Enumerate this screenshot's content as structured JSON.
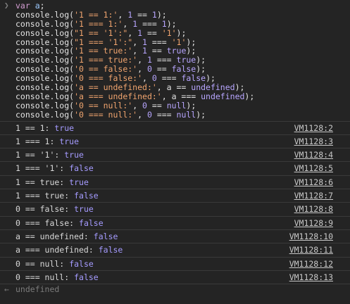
{
  "input_code": [
    [
      {
        "t": "var",
        "c": "kw"
      },
      {
        "t": " a",
        "c": "var"
      },
      {
        "t": ";",
        "c": "plain"
      }
    ],
    [
      {
        "t": "console.log(",
        "c": "plain"
      },
      {
        "t": "'1 == 1:'",
        "c": "str"
      },
      {
        "t": ", ",
        "c": "plain"
      },
      {
        "t": "1",
        "c": "num"
      },
      {
        "t": " == ",
        "c": "plain"
      },
      {
        "t": "1",
        "c": "num"
      },
      {
        "t": ");",
        "c": "plain"
      }
    ],
    [
      {
        "t": "console.log(",
        "c": "plain"
      },
      {
        "t": "'1 === 1:'",
        "c": "str"
      },
      {
        "t": ", ",
        "c": "plain"
      },
      {
        "t": "1",
        "c": "num"
      },
      {
        "t": " === ",
        "c": "plain"
      },
      {
        "t": "1",
        "c": "num"
      },
      {
        "t": ");",
        "c": "plain"
      }
    ],
    [
      {
        "t": "console.log(",
        "c": "plain"
      },
      {
        "t": "\"1 == '1':\"",
        "c": "str"
      },
      {
        "t": ", ",
        "c": "plain"
      },
      {
        "t": "1",
        "c": "num"
      },
      {
        "t": " == ",
        "c": "plain"
      },
      {
        "t": "'1'",
        "c": "str"
      },
      {
        "t": ");",
        "c": "plain"
      }
    ],
    [
      {
        "t": "console.log(",
        "c": "plain"
      },
      {
        "t": "\"1 === '1':\"",
        "c": "str"
      },
      {
        "t": ", ",
        "c": "plain"
      },
      {
        "t": "1",
        "c": "num"
      },
      {
        "t": " === ",
        "c": "plain"
      },
      {
        "t": "'1'",
        "c": "str"
      },
      {
        "t": ");",
        "c": "plain"
      }
    ],
    [
      {
        "t": "console.log(",
        "c": "plain"
      },
      {
        "t": "'1 == true:'",
        "c": "str"
      },
      {
        "t": ", ",
        "c": "plain"
      },
      {
        "t": "1",
        "c": "num"
      },
      {
        "t": " == ",
        "c": "plain"
      },
      {
        "t": "true",
        "c": "lit"
      },
      {
        "t": ");",
        "c": "plain"
      }
    ],
    [
      {
        "t": "console.log(",
        "c": "plain"
      },
      {
        "t": "'1 === true:'",
        "c": "str"
      },
      {
        "t": ", ",
        "c": "plain"
      },
      {
        "t": "1",
        "c": "num"
      },
      {
        "t": " === ",
        "c": "plain"
      },
      {
        "t": "true",
        "c": "lit"
      },
      {
        "t": ");",
        "c": "plain"
      }
    ],
    [
      {
        "t": "console.log(",
        "c": "plain"
      },
      {
        "t": "'0 == false:'",
        "c": "str"
      },
      {
        "t": ", ",
        "c": "plain"
      },
      {
        "t": "0",
        "c": "num"
      },
      {
        "t": " == ",
        "c": "plain"
      },
      {
        "t": "false",
        "c": "lit"
      },
      {
        "t": ");",
        "c": "plain"
      }
    ],
    [
      {
        "t": "console.log(",
        "c": "plain"
      },
      {
        "t": "'0 === false:'",
        "c": "str"
      },
      {
        "t": ", ",
        "c": "plain"
      },
      {
        "t": "0",
        "c": "num"
      },
      {
        "t": " === ",
        "c": "plain"
      },
      {
        "t": "false",
        "c": "lit"
      },
      {
        "t": ");",
        "c": "plain"
      }
    ],
    [
      {
        "t": "console.log(",
        "c": "plain"
      },
      {
        "t": "'a == undefined:'",
        "c": "str"
      },
      {
        "t": ", a == ",
        "c": "plain"
      },
      {
        "t": "undefined",
        "c": "lit"
      },
      {
        "t": ");",
        "c": "plain"
      }
    ],
    [
      {
        "t": "console.log(",
        "c": "plain"
      },
      {
        "t": "'a === undefined:'",
        "c": "str"
      },
      {
        "t": ", a === ",
        "c": "plain"
      },
      {
        "t": "undefined",
        "c": "lit"
      },
      {
        "t": ");",
        "c": "plain"
      }
    ],
    [
      {
        "t": "console.log(",
        "c": "plain"
      },
      {
        "t": "'0 == null:'",
        "c": "str"
      },
      {
        "t": ", ",
        "c": "plain"
      },
      {
        "t": "0",
        "c": "num"
      },
      {
        "t": " == ",
        "c": "plain"
      },
      {
        "t": "null",
        "c": "lit"
      },
      {
        "t": ");",
        "c": "plain"
      }
    ],
    [
      {
        "t": "console.log(",
        "c": "plain"
      },
      {
        "t": "'0 === null:'",
        "c": "str"
      },
      {
        "t": ", ",
        "c": "plain"
      },
      {
        "t": "0",
        "c": "num"
      },
      {
        "t": " === ",
        "c": "plain"
      },
      {
        "t": "null",
        "c": "lit"
      },
      {
        "t": ");",
        "c": "plain"
      }
    ]
  ],
  "logs": [
    {
      "text": "1 == 1:",
      "value": "true",
      "source": "VM1128:2"
    },
    {
      "text": "1 === 1:",
      "value": "true",
      "source": "VM1128:3"
    },
    {
      "text": "1 == '1':",
      "value": "true",
      "source": "VM1128:4"
    },
    {
      "text": "1 === '1':",
      "value": "false",
      "source": "VM1128:5"
    },
    {
      "text": "1 == true:",
      "value": "true",
      "source": "VM1128:6"
    },
    {
      "text": "1 === true:",
      "value": "false",
      "source": "VM1128:7"
    },
    {
      "text": "0 == false:",
      "value": "true",
      "source": "VM1128:8"
    },
    {
      "text": "0 === false:",
      "value": "false",
      "source": "VM1128:9"
    },
    {
      "text": "a == undefined:",
      "value": "false",
      "source": "VM1128:10"
    },
    {
      "text": "a === undefined:",
      "value": "false",
      "source": "VM1128:11"
    },
    {
      "text": "0 == null:",
      "value": "false",
      "source": "VM1128:12"
    },
    {
      "text": "0 === null:",
      "value": "false",
      "source": "VM1128:13"
    }
  ],
  "result": {
    "icon": "return-arrow-icon",
    "text": "undefined"
  },
  "colors": {
    "background": "#242424",
    "keyword": "#d49dd2",
    "string": "#f0a46e",
    "number": "#b8a6ff",
    "value": "#a59bff"
  }
}
